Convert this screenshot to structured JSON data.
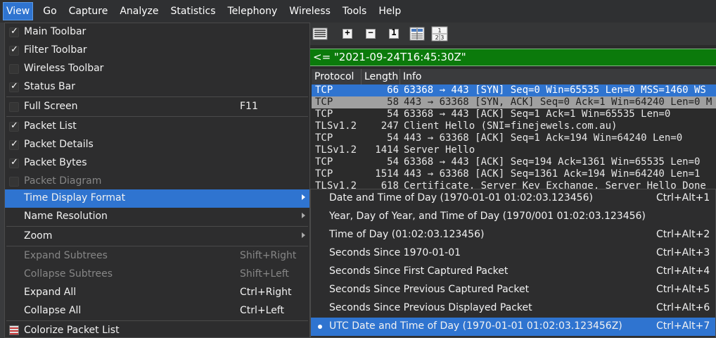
{
  "menubar": {
    "items": [
      "View",
      "Go",
      "Capture",
      "Analyze",
      "Statistics",
      "Telephony",
      "Wireless",
      "Tools",
      "Help"
    ]
  },
  "filter": {
    "text": "<= \"2021-09-24T16:45:30Z\""
  },
  "packet_list": {
    "headers": [
      "Protocol",
      "Length",
      "Info"
    ],
    "rows": [
      {
        "protocol": "TCP",
        "length": "66",
        "info": "63368 → 443 [SYN] Seq=0 Win=65535 Len=0 MSS=1460 WS"
      },
      {
        "protocol": "TCP",
        "length": "58",
        "info": "443 → 63368 [SYN, ACK] Seq=0 Ack=1 Win=64240 Len=0 M"
      },
      {
        "protocol": "TCP",
        "length": "54",
        "info": "63368 → 443 [ACK] Seq=1 Ack=1 Win=65535 Len=0"
      },
      {
        "protocol": "TLSv1.2",
        "length": "247",
        "info": "Client Hello (SNI=finejewels.com.au)"
      },
      {
        "protocol": "TCP",
        "length": "54",
        "info": "443 → 63368 [ACK] Seq=1 Ack=194 Win=64240 Len=0"
      },
      {
        "protocol": "TLSv1.2",
        "length": "1414",
        "info": "Server Hello"
      },
      {
        "protocol": "TCP",
        "length": "54",
        "info": "63368 → 443 [ACK] Seq=194 Ack=1361 Win=65535 Len=0"
      },
      {
        "protocol": "TCP",
        "length": "1514",
        "info": "443 → 63368 [ACK] Seq=1361 Ack=194 Win=64240 Len=1"
      },
      {
        "protocol": "TLSv1.2",
        "length": "618",
        "info": "Certificate, Server Key Exchange, Server Hello Done"
      }
    ]
  },
  "view_menu": {
    "items": [
      {
        "label": "Main Toolbar",
        "checked": "✓"
      },
      {
        "label": "Filter Toolbar",
        "checked": "✓"
      },
      {
        "label": "Wireless Toolbar",
        "checked": ""
      },
      {
        "label": "Status Bar",
        "checked": "✓"
      },
      {
        "label": "Full Screen",
        "checked": "",
        "shortcut": "F11"
      },
      {
        "label": "Packet List",
        "checked": "✓"
      },
      {
        "label": "Packet Details",
        "checked": "✓"
      },
      {
        "label": "Packet Bytes",
        "checked": "✓"
      },
      {
        "label": "Packet Diagram",
        "checked": ""
      },
      {
        "label": "Time Display Format"
      },
      {
        "label": "Name Resolution"
      },
      {
        "label": "Zoom"
      },
      {
        "label": "Expand Subtrees",
        "shortcut": "Shift+Right"
      },
      {
        "label": "Collapse Subtrees",
        "shortcut": "Shift+Left"
      },
      {
        "label": "Expand All",
        "shortcut": "Ctrl+Right"
      },
      {
        "label": "Collapse All",
        "shortcut": "Ctrl+Left"
      },
      {
        "label": "Colorize Packet List"
      }
    ]
  },
  "time_format_submenu": {
    "items": [
      {
        "label": "Date and Time of Day (1970-01-01 01:02:03.123456)",
        "shortcut": "Ctrl+Alt+1"
      },
      {
        "label": "Year, Day of Year, and Time of Day (1970/001 01:02:03.123456)",
        "shortcut": ""
      },
      {
        "label": "Time of Day (01:02:03.123456)",
        "shortcut": "Ctrl+Alt+2"
      },
      {
        "label": "Seconds Since 1970-01-01",
        "shortcut": "Ctrl+Alt+3"
      },
      {
        "label": "Seconds Since First Captured Packet",
        "shortcut": "Ctrl+Alt+4"
      },
      {
        "label": "Seconds Since Previous Captured Packet",
        "shortcut": "Ctrl+Alt+5"
      },
      {
        "label": "Seconds Since Previous Displayed Packet",
        "shortcut": "Ctrl+Alt+6"
      },
      {
        "label": "UTC Date and Time of Day (1970-01-01 01:02:03.123456Z)",
        "shortcut": "Ctrl+Alt+7"
      }
    ]
  },
  "toolbar": {
    "icons": [
      "colorize-icon",
      "zoom-in-icon",
      "zoom-out-icon",
      "zoom-normal-icon",
      "resize-columns-icon",
      "time-format-icon"
    ],
    "zoom_in_glyph": "+",
    "zoom_out_glyph": "−",
    "zoom_normal_glyph": "1",
    "time_format_glyph_top": "1",
    "time_format_glyph_bottom": "2 3"
  },
  "colors": {
    "accent": "#2f74d0",
    "filter_bar": "#0b7a0b",
    "menu_bg": "#2d2d2e"
  }
}
